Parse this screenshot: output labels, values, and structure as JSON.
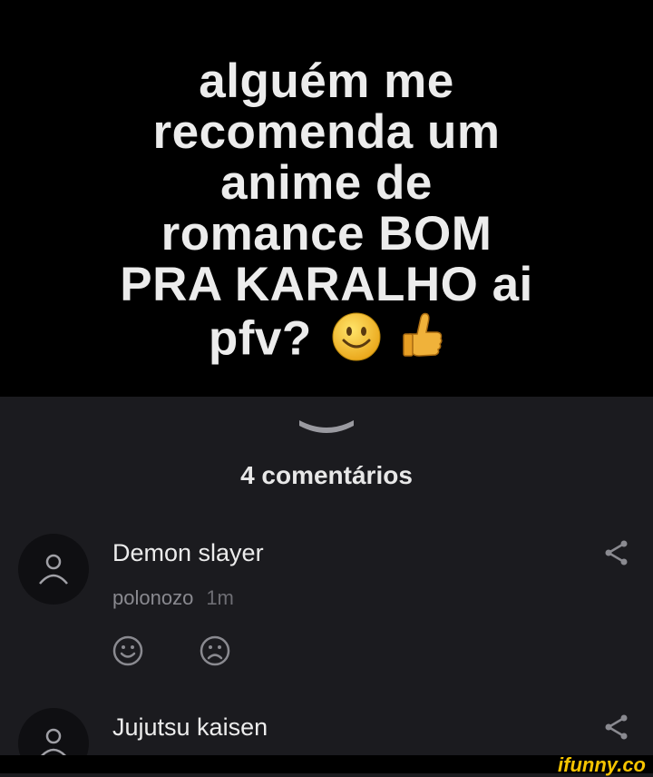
{
  "post": {
    "lines": [
      "alguém me",
      "recomenda um",
      "anime de",
      "romance BOM",
      "PRA KARALHO ai",
      "pfv?"
    ]
  },
  "comments_header": {
    "count_label": "4 comentários"
  },
  "comments": [
    {
      "text": "Demon slayer",
      "author": "polonozo",
      "time": "1m"
    },
    {
      "text": "Jujutsu kaisen"
    }
  ],
  "footer": {
    "brand": "ifunny.co"
  }
}
